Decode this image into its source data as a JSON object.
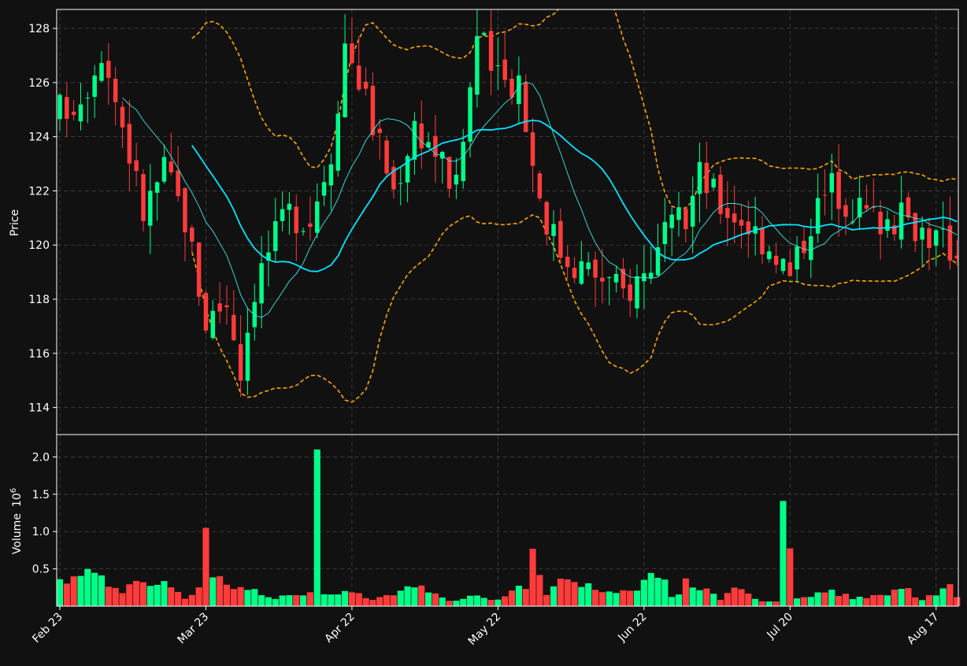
{
  "chart_data": {
    "type": "candlestick",
    "ylabel_price": "Price",
    "ylabel_volume": "Volume",
    "volume_multiplier": "10",
    "volume_exponent": "6",
    "price_ylim": [
      113,
      128.7
    ],
    "volume_ylim": [
      0,
      2.3
    ],
    "price_ticks": [
      114,
      116,
      118,
      120,
      122,
      124,
      126,
      128
    ],
    "volume_ticks": [
      0.5,
      1.0,
      1.5,
      2.0
    ],
    "volume_tick_labels": [
      "0.5",
      "1.0",
      "1.5",
      "2.0"
    ],
    "x_ticks": [
      {
        "label": "Feb 23",
        "index": 0
      },
      {
        "label": "Mar 23",
        "index": 21
      },
      {
        "label": "Apr 22",
        "index": 42
      },
      {
        "label": "May 22",
        "index": 63
      },
      {
        "label": "Jun 22",
        "index": 84
      },
      {
        "label": "Jul 20",
        "index": 105
      },
      {
        "label": "Aug 17",
        "index": 126
      }
    ],
    "grid": true,
    "colors": {
      "up": "#00ff88",
      "down": "#ff3b3b",
      "ma_slow": "#00e5ff",
      "ma_fast": "#3ee8e8",
      "band": "#ffa500",
      "background": "#111111",
      "text": "#ffffff",
      "grid": "#444444"
    },
    "close_path": [
      [
        0,
        125.0
      ],
      [
        3,
        125.5
      ],
      [
        6,
        127.3
      ],
      [
        9,
        124.5
      ],
      [
        12,
        121.2
      ],
      [
        15,
        122.8
      ],
      [
        18,
        121.0
      ],
      [
        21,
        117.2
      ],
      [
        24,
        118.0
      ],
      [
        26,
        115.5
      ],
      [
        28,
        118.5
      ],
      [
        30,
        119.8
      ],
      [
        33,
        121.2
      ],
      [
        36,
        121.0
      ],
      [
        39,
        123.5
      ],
      [
        41,
        127.5
      ],
      [
        43,
        126.2
      ],
      [
        45,
        124.5
      ],
      [
        48,
        122.0
      ],
      [
        51,
        124.5
      ],
      [
        54,
        123.5
      ],
      [
        57,
        122.0
      ],
      [
        60,
        127.8
      ],
      [
        63,
        126.0
      ],
      [
        66,
        126.2
      ],
      [
        68,
        123.0
      ],
      [
        70,
        121.0
      ],
      [
        72,
        119.8
      ],
      [
        75,
        119.2
      ],
      [
        78,
        118.8
      ],
      [
        81,
        118.2
      ],
      [
        84,
        119.0
      ],
      [
        87,
        120.2
      ],
      [
        90,
        121.0
      ],
      [
        92,
        122.6
      ],
      [
        95,
        121.5
      ],
      [
        98,
        121.0
      ],
      [
        100,
        120.5
      ],
      [
        103,
        119.8
      ],
      [
        105,
        118.8
      ],
      [
        108,
        121.0
      ],
      [
        111,
        122.2
      ],
      [
        114,
        121.5
      ],
      [
        117,
        121.0
      ],
      [
        120,
        121.0
      ],
      [
        123,
        120.8
      ],
      [
        126,
        120.2
      ],
      [
        129,
        119.8
      ]
    ],
    "up_highlights": [
      38,
      99
    ],
    "volume_path": [
      [
        0,
        0.3
      ],
      [
        3,
        0.45
      ],
      [
        4,
        0.52
      ],
      [
        6,
        0.33
      ],
      [
        9,
        0.22
      ],
      [
        12,
        0.3
      ],
      [
        15,
        0.3
      ],
      [
        18,
        0.1
      ],
      [
        20,
        0.3
      ],
      [
        21,
        1.05
      ],
      [
        22,
        0.4
      ],
      [
        26,
        0.27
      ],
      [
        30,
        0.12
      ],
      [
        36,
        0.15
      ],
      [
        37,
        2.1
      ],
      [
        38,
        0.14
      ],
      [
        42,
        0.2
      ],
      [
        45,
        0.08
      ],
      [
        50,
        0.22
      ],
      [
        52,
        0.28
      ],
      [
        56,
        0.08
      ],
      [
        60,
        0.15
      ],
      [
        63,
        0.08
      ],
      [
        67,
        0.27
      ],
      [
        68,
        0.77
      ],
      [
        70,
        0.17
      ],
      [
        72,
        0.33
      ],
      [
        76,
        0.25
      ],
      [
        80,
        0.15
      ],
      [
        83,
        0.27
      ],
      [
        86,
        0.48
      ],
      [
        88,
        0.1
      ],
      [
        90,
        0.3
      ],
      [
        92,
        0.27
      ],
      [
        95,
        0.1
      ],
      [
        97,
        0.3
      ],
      [
        100,
        0.08
      ],
      [
        103,
        0.08
      ],
      [
        104,
        1.41
      ],
      [
        106,
        0.1
      ],
      [
        110,
        0.2
      ],
      [
        114,
        0.12
      ],
      [
        118,
        0.15
      ],
      [
        121,
        0.25
      ],
      [
        124,
        0.1
      ],
      [
        127,
        0.2
      ],
      [
        128,
        0.29
      ],
      [
        129,
        0.15
      ]
    ],
    "n_bars": 130
  }
}
